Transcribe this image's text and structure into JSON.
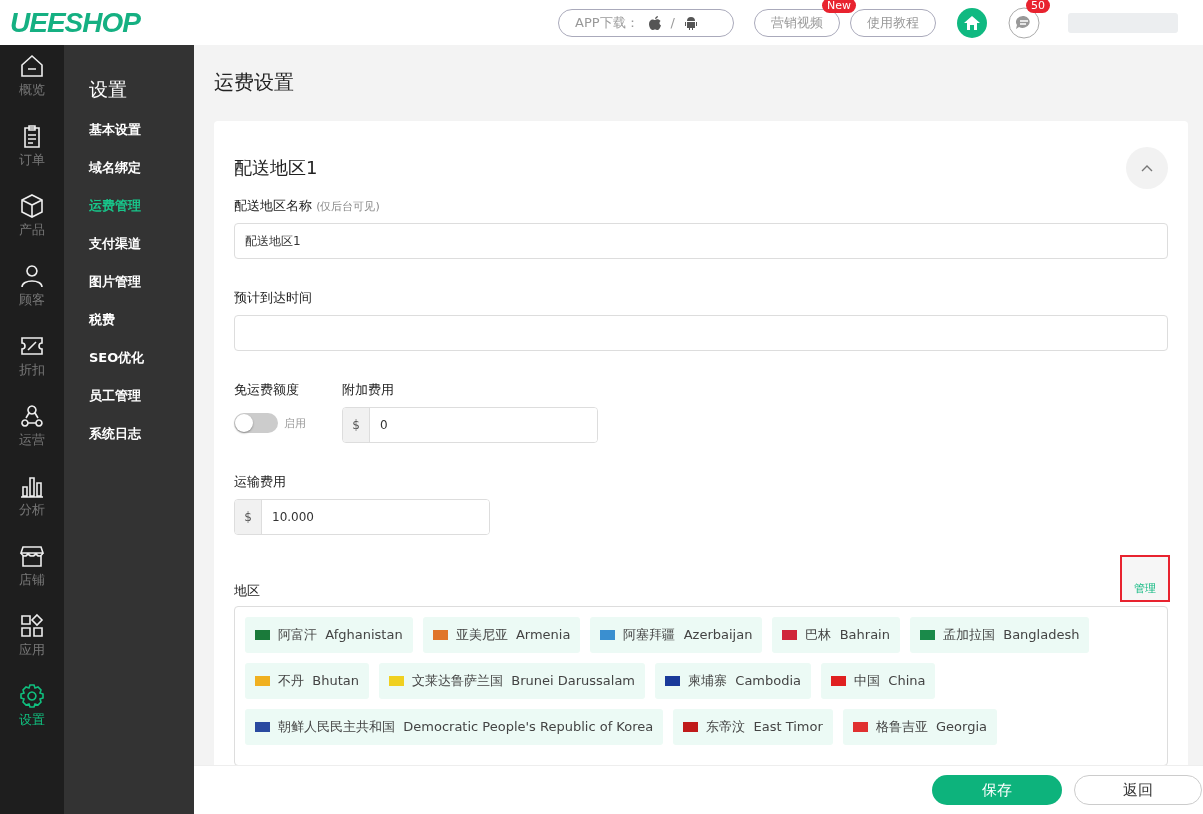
{
  "header": {
    "logo": "UEESHOP",
    "app_download": {
      "label": "APP下载：",
      "separator": "/"
    },
    "buttons": [
      {
        "label": "营销视频",
        "badge": "New"
      },
      {
        "label": "使用教程"
      }
    ],
    "message_count": "50"
  },
  "rail": [
    {
      "label": "概览",
      "selected": false
    },
    {
      "label": "订单",
      "selected": false
    },
    {
      "label": "产品",
      "selected": false
    },
    {
      "label": "顾客",
      "selected": false
    },
    {
      "label": "折扣",
      "selected": false
    },
    {
      "label": "运营",
      "selected": false
    },
    {
      "label": "分析",
      "selected": false
    },
    {
      "label": "店铺",
      "selected": false
    },
    {
      "label": "应用",
      "selected": false
    },
    {
      "label": "设置",
      "selected": true
    }
  ],
  "submenu": {
    "title": "设置",
    "items": [
      {
        "label": "基本设置",
        "selected": false
      },
      {
        "label": "域名绑定",
        "selected": false
      },
      {
        "label": "运费管理",
        "selected": true
      },
      {
        "label": "支付渠道",
        "selected": false
      },
      {
        "label": "图片管理",
        "selected": false
      },
      {
        "label": "税费",
        "selected": false
      },
      {
        "label": "SEO优化",
        "selected": false
      },
      {
        "label": "员工管理",
        "selected": false
      },
      {
        "label": "系统日志",
        "selected": false
      }
    ]
  },
  "page_title": "运费设置",
  "zone": {
    "title": "配送地区1",
    "expanded": true,
    "name_field": {
      "label": "配送地区名称",
      "hint": "(仅后台可见)",
      "value": "配送地区1"
    },
    "eta_field": {
      "label": "预计到达时间"
    },
    "free_shipping": {
      "label": "免运费额度",
      "on": false,
      "toggle_label": "启用"
    },
    "extra_fee": {
      "label": "附加费用",
      "prefix": "$",
      "value": "0"
    },
    "shipping_fee": {
      "label": "运输费用",
      "prefix": "$",
      "value": "10.000"
    },
    "regions": {
      "label": "地区",
      "manage": "管理",
      "highlighted": true,
      "items": [
        {
          "cn": "阿富汗",
          "en": "Afghanistan",
          "color": "#1a7a3a"
        },
        {
          "cn": "亚美尼亚",
          "en": "Armenia",
          "color": "#e0752a"
        },
        {
          "cn": "阿塞拜疆",
          "en": "Azerbaijan",
          "color": "#3a8fd0"
        },
        {
          "cn": "巴林",
          "en": "Bahrain",
          "color": "#d0253a"
        },
        {
          "cn": "孟加拉国",
          "en": "Bangladesh",
          "color": "#1a8a4a"
        },
        {
          "cn": "不丹",
          "en": "Bhutan",
          "color": "#f0b020"
        },
        {
          "cn": "文莱达鲁萨兰国",
          "en": "Brunei Darussalam",
          "color": "#f0d020"
        },
        {
          "cn": "柬埔寨",
          "en": "Cambodia",
          "color": "#1a3a9a"
        },
        {
          "cn": "中国",
          "en": "China",
          "color": "#e02020"
        },
        {
          "cn": "朝鲜人民民主共和国",
          "en": "Democratic People's Republic of Korea",
          "color": "#2a4aa0"
        },
        {
          "cn": "东帝汶",
          "en": "East Timor",
          "color": "#c01a1a"
        },
        {
          "cn": "格鲁吉亚",
          "en": "Georgia",
          "color": "#e03030"
        }
      ]
    }
  },
  "footer": {
    "save": "保存",
    "back": "返回"
  }
}
